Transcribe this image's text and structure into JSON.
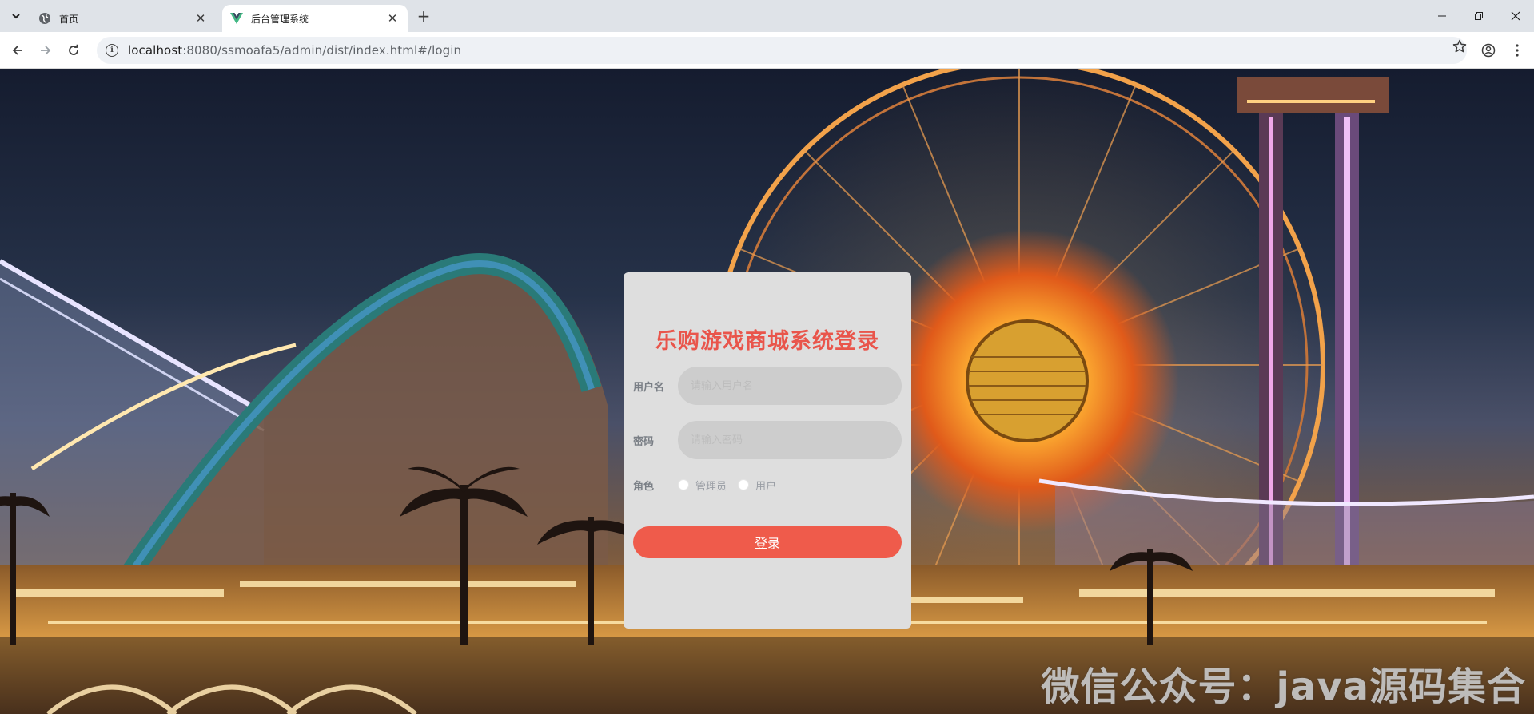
{
  "browser": {
    "tabs": [
      {
        "title": "首页",
        "icon": "globe-icon",
        "active": false
      },
      {
        "title": "后台管理系统",
        "icon": "vue-logo-icon",
        "active": true
      }
    ],
    "url_host": "localhost",
    "url_rest": ":8080/ssmoafa5/admin/dist/index.html#/login"
  },
  "login": {
    "title": "乐购游戏商城系统登录",
    "username_label": "用户名",
    "username_placeholder": "请输入用户名",
    "password_label": "密码",
    "password_placeholder": "请输入密码",
    "role_label": "角色",
    "roles": [
      "管理员",
      "用户"
    ],
    "submit_label": "登录",
    "accent_color": "#ef5b4b"
  },
  "watermark": "微信公众号：java源码集合"
}
